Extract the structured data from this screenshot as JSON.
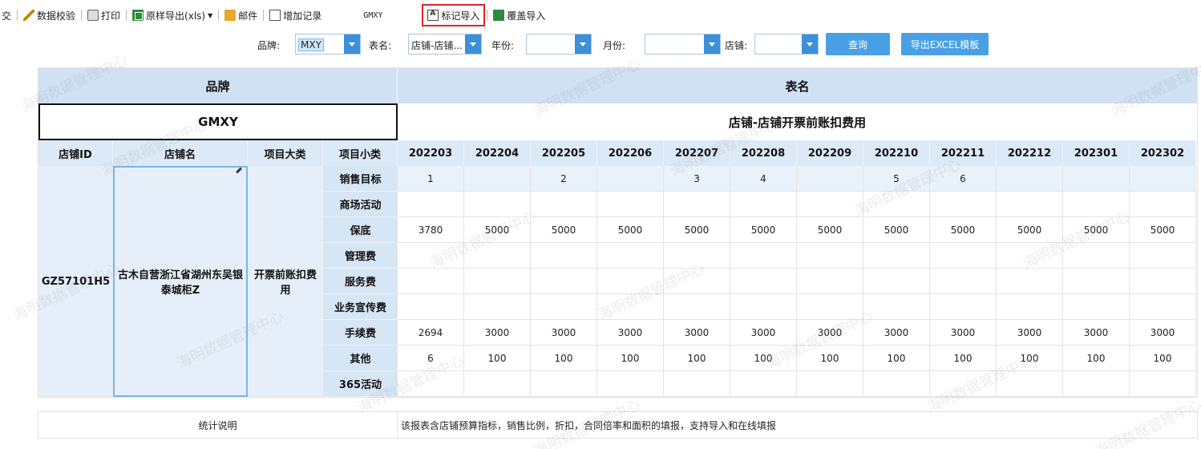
{
  "toolbar": {
    "items": [
      {
        "label": "交"
      },
      {
        "label": "数据校验",
        "icon": "check-icon"
      },
      {
        "label": "打印",
        "icon": "print-icon"
      },
      {
        "label": "原样导出(xls)",
        "icon": "excel-icon"
      },
      {
        "label": "邮件",
        "icon": "mail-icon"
      },
      {
        "label": "增加记录",
        "icon": "add-record-icon"
      },
      {
        "label": "标记导入",
        "icon": "import-icon"
      },
      {
        "label": "覆盖导入",
        "icon": "cover-import-icon"
      }
    ],
    "brand_code": "GMXY"
  },
  "filters": {
    "brand_label": "品牌:",
    "brand_value": "MXY",
    "table_label": "表名:",
    "table_value": "店铺-店铺...",
    "year_label": "年份:",
    "year_value": "",
    "month_label": "月份:",
    "month_value": "",
    "store_label": "店铺:",
    "store_value": "",
    "query_button": "查询",
    "export_button": "导出EXCEL模板"
  },
  "report": {
    "brand_header": "品牌",
    "table_header": "表名",
    "brand_value": "GMXY",
    "table_value": "店铺-店铺开票前账扣费用",
    "columns": {
      "store_id": "店铺ID",
      "store_name": "店铺名",
      "category": "项目大类",
      "subcategory": "项目小类"
    },
    "months": [
      "202203",
      "202204",
      "202205",
      "202206",
      "202207",
      "202208",
      "202209",
      "202210",
      "202211",
      "202212",
      "202301",
      "202302"
    ],
    "store_id": "GZ57101H5",
    "store_name": "古木自营浙江省湖州东吴银泰城柜Z",
    "category": "开票前账扣费用",
    "rows": [
      {
        "name": "销售目标",
        "values": [
          "1",
          "",
          "2",
          "",
          "3",
          "4",
          "",
          "5",
          "6",
          "",
          "",
          ""
        ]
      },
      {
        "name": "商场活动",
        "values": [
          "",
          "",
          "",
          "",
          "",
          "",
          "",
          "",
          "",
          "",
          "",
          ""
        ]
      },
      {
        "name": "保底",
        "values": [
          "3780",
          "5000",
          "5000",
          "5000",
          "5000",
          "5000",
          "5000",
          "5000",
          "5000",
          "5000",
          "5000",
          "5000"
        ]
      },
      {
        "name": "管理费",
        "values": [
          "",
          "",
          "",
          "",
          "",
          "",
          "",
          "",
          "",
          "",
          "",
          ""
        ]
      },
      {
        "name": "服务费",
        "values": [
          "",
          "",
          "",
          "",
          "",
          "",
          "",
          "",
          "",
          "",
          "",
          ""
        ]
      },
      {
        "name": "业务宣传费",
        "values": [
          "",
          "",
          "",
          "",
          "",
          "",
          "",
          "",
          "",
          "",
          "",
          ""
        ]
      },
      {
        "name": "手续费",
        "values": [
          "2694",
          "3000",
          "3000",
          "3000",
          "3000",
          "3000",
          "3000",
          "3000",
          "3000",
          "3000",
          "3000",
          "3000"
        ]
      },
      {
        "name": "其他",
        "values": [
          "6",
          "100",
          "100",
          "100",
          "100",
          "100",
          "100",
          "100",
          "100",
          "100",
          "100",
          "100"
        ]
      },
      {
        "name": "365活动",
        "values": [
          "",
          "",
          "",
          "",
          "",
          "",
          "",
          "",
          "",
          "",
          "",
          ""
        ]
      }
    ]
  },
  "footer": {
    "label": "统计说明",
    "text": "该报表含店铺预算指标，销售比例，折扣，合同倍率和面积的填报，支持导入和在线填报"
  },
  "watermark": "海明数据管理中心",
  "colors": {
    "header_bg": "#cfe1f3",
    "button_bg": "#49a0e5",
    "highlight": "#e02424"
  }
}
